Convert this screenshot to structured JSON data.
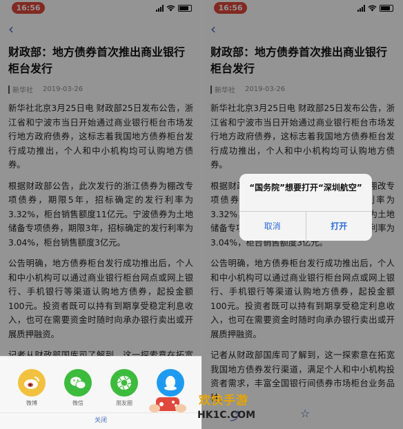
{
  "status_time": "16:56",
  "article": {
    "title": "财政部：地方债券首次推出商业银行柜台发行",
    "source": "新华社",
    "date": "2019-03-26",
    "paragraphs": [
      "新华社北京3月25日电 财政部25日发布公告，浙江省和宁波市当日开始通过商业银行柜台市场发行地方政府债券，这标志着我国地方债券柜台发行成功推出，个人和中小机构均可认购地方债券。",
      "根据财政部公告，此次发行的浙江债券为棚改专项债券，期限5年，招标确定的发行利率为3.32%，柜台销售额度11亿元。宁波债券为土地储备专项债券，期限3年，招标确定的发行利率为3.04%，柜台销售额度3亿元。",
      "公告明确，地方债券柜台发行成功推出后，个人和中小机构可以通过商业银行柜台网点或网上银行、手机银行等渠道认购地方债券，起投金额100元。投资者既可以持有到期享受稳定利息收入，也可在需要资金时随时向承办银行卖出或开展质押融资。",
      "记者从财政部国库司了解到，这一探索意在拓宽我国地方债券发行渠道，满足个人和中小机构投资者需求，丰富全国银行间债券市场柜台业务品种。"
    ]
  },
  "share_sheet": {
    "items": [
      {
        "label": "微博",
        "icon": "weibo-icon"
      },
      {
        "label": "微信",
        "icon": "wechat-icon"
      },
      {
        "label": "朋友圈",
        "icon": "moments-icon"
      },
      {
        "label": "QQ",
        "icon": "qq-icon"
      }
    ],
    "close_label": "关闭"
  },
  "alert": {
    "message": "“国务院”想要打开“深圳航空”",
    "cancel": "取消",
    "open": "打开"
  },
  "watermark": {
    "text": "欢快手游",
    "url": "HK1C.COM"
  }
}
